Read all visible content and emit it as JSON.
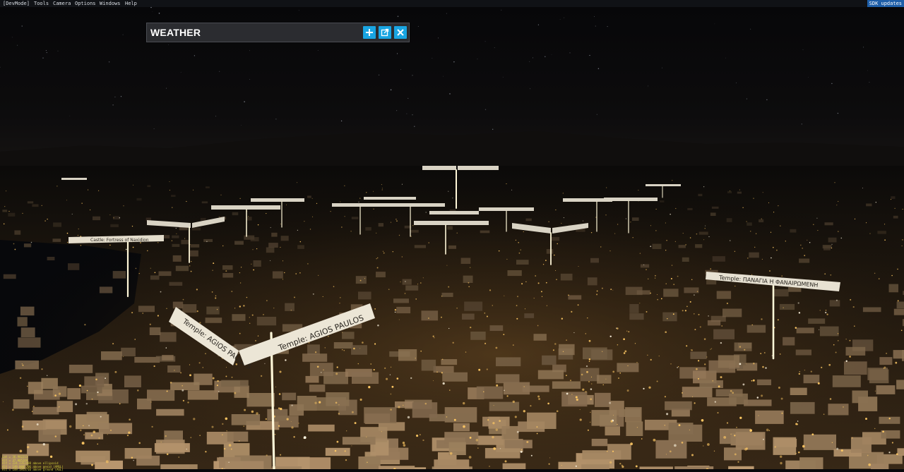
{
  "menubar": {
    "items": [
      "[DevMode]",
      "Tools",
      "Camera",
      "Options",
      "Windows",
      "Help"
    ],
    "sdk_label": "SDK updates"
  },
  "weather_panel": {
    "title": "WEATHER",
    "buttons": [
      {
        "name": "add-button",
        "icon": "plus-icon"
      },
      {
        "name": "undock-button",
        "icon": "external-window-icon"
      },
      {
        "name": "close-button",
        "icon": "close-icon"
      }
    ],
    "button_color": "#19a5e2"
  },
  "scene": {
    "labels": {
      "agios_paulos": "Temple: AGIOS PAULOS",
      "panagia": "Temple: ΠΑΝΑΓΙΑ Η ΦΑΝΑΙΡΩΜΕΝΗ",
      "castle": "Castle: Fortress of Naxidion"
    },
    "light_color": "#ffc964"
  },
  "debug": {
    "lines": [
      "Lat = 36.982213",
      "Alt = 37.005248",
      "Alt = 224.2352498 above ellipsoid",
      "Alt = 149.0007706 above geoid (AMSL)",
      "Alt = 149.1953716 above ground (AGL)"
    ]
  }
}
